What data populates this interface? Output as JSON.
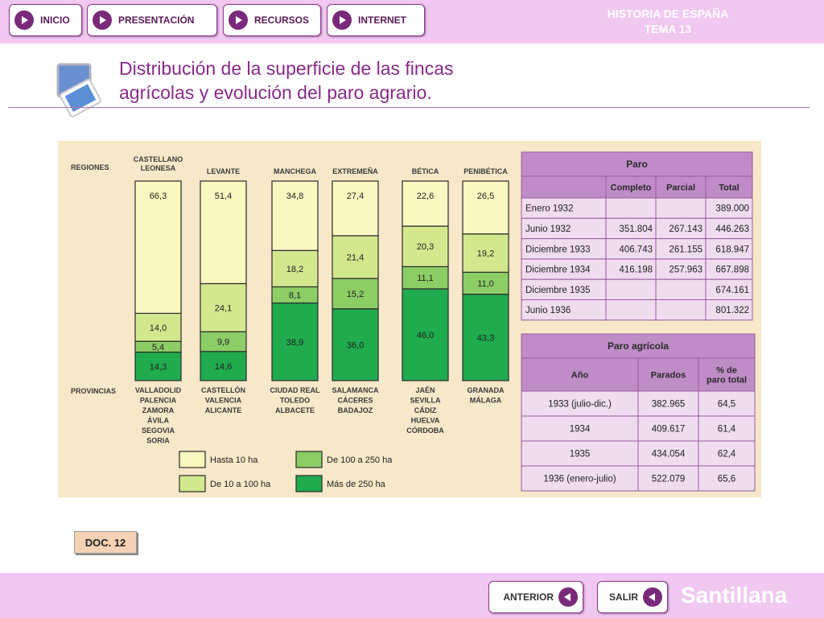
{
  "nav": {
    "inicio": "INICIO",
    "presentacion": "PRESENTACIÓN",
    "recursos": "RECURSOS",
    "internet": "INTERNET"
  },
  "brand": {
    "line1": "HISTORIA DE ESPAÑA",
    "line2": "TEMA 13"
  },
  "title": {
    "line1": "Distribución de la superficie de las fincas",
    "line2": "agrícolas y evolución del paro agrario."
  },
  "doc_label": "DOC. 12",
  "footer": {
    "anterior": "ANTERIOR",
    "salir": "SALIR",
    "logo": "Santillana"
  },
  "colors": {
    "hasta10": "#fbf7c0",
    "de10a100": "#d3e88e",
    "de100a250": "#8ccd66",
    "mas250": "#1fab4e",
    "table_header": "#c08cc8",
    "table_cell": "#efdcef",
    "accent": "#8a2a8a"
  },
  "chart_data": [
    {
      "type": "bar",
      "stacked": true,
      "row_labels": {
        "regions": "REGIONES",
        "provinces": "PROVINCIAS"
      },
      "categories": [
        "CASTELLANO LEONESA",
        "LEVANTE",
        "MANCHEGA",
        "EXTREMEÑA",
        "BÉTICA",
        "PENIBÉTICA"
      ],
      "provinces": [
        [
          "VALLADOLID",
          "PALENCIA",
          "ZAMORA",
          "ÁVILA",
          "SEGOVIA",
          "SORIA"
        ],
        [
          "CASTELLÓN",
          "VALENCIA",
          "ALICANTE"
        ],
        [
          "CIUDAD REAL",
          "TOLEDO",
          "ALBACETE"
        ],
        [
          "SALAMANCA",
          "CÁCERES",
          "BADAJOZ"
        ],
        [
          "JAÉN",
          "SEVILLA",
          "CÁDIZ",
          "HUELVA",
          "CÓRDOBA"
        ],
        [
          "GRANADA",
          "MÁLAGA"
        ]
      ],
      "series": [
        {
          "name": "Hasta 10 ha",
          "values": [
            66.3,
            51.4,
            34.8,
            27.4,
            22.6,
            26.5
          ],
          "labels": [
            "66,3",
            "51,4",
            "34,8",
            "27,4",
            "22,6",
            "26,5"
          ]
        },
        {
          "name": "De 10 a 100 ha",
          "values": [
            14.0,
            24.1,
            18.2,
            21.4,
            20.3,
            19.2
          ],
          "labels": [
            "14,0",
            "24,1",
            "18,2",
            "21,4",
            "20,3",
            "19,2"
          ]
        },
        {
          "name": "De 100 a 250 ha",
          "values": [
            5.4,
            9.9,
            8.1,
            15.2,
            11.1,
            11.0
          ],
          "labels": [
            "5,4",
            "9,9",
            "8,1",
            "15,2",
            "11,1",
            "11,0"
          ]
        },
        {
          "name": "Más de 250 ha",
          "values": [
            14.3,
            14.6,
            38.9,
            36.0,
            46.0,
            43.3
          ],
          "labels": [
            "14,3",
            "14,6",
            "38,9",
            "36,0",
            "46,0",
            "43,3"
          ]
        }
      ],
      "ylim": [
        0,
        100
      ],
      "legend": "bottom"
    },
    {
      "type": "table",
      "title": "Paro",
      "columns": [
        "",
        "Completo",
        "Parcial",
        "Total"
      ],
      "rows": [
        [
          "Enero 1932",
          "",
          "",
          "389.000"
        ],
        [
          "Junio 1932",
          "351.804",
          "267.143",
          "446.263"
        ],
        [
          "Diciembre 1933",
          "406.743",
          "261.155",
          "618.947"
        ],
        [
          "Diciembre 1934",
          "416.198",
          "257.963",
          "667.898"
        ],
        [
          "Diciembre 1935",
          "",
          "",
          "674.161"
        ],
        [
          "Junio 1936",
          "",
          "",
          "801.322"
        ]
      ]
    },
    {
      "type": "table",
      "title": "Paro agrícola",
      "columns": [
        "Año",
        "Parados",
        "% de paro total"
      ],
      "rows": [
        [
          "1933 (julio-dic.)",
          "382.965",
          "64,5"
        ],
        [
          "1934",
          "409.617",
          "61,4"
        ],
        [
          "1935",
          "434.054",
          "62,4"
        ],
        [
          "1936 (enero-julio)",
          "522.079",
          "65,6"
        ]
      ]
    }
  ]
}
